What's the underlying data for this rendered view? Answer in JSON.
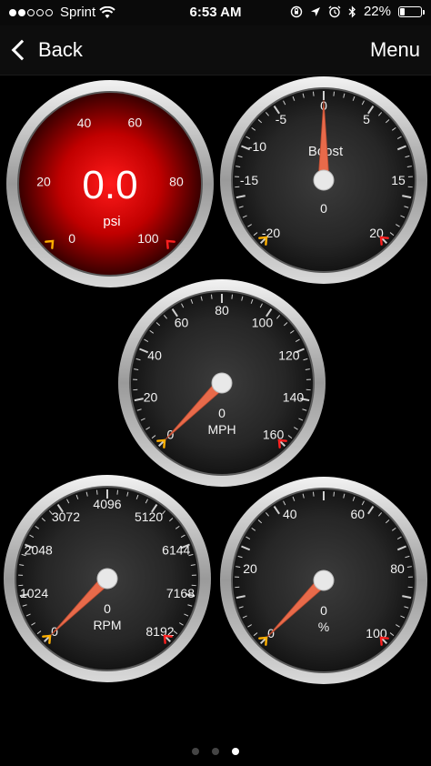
{
  "status": {
    "carrier": "Sprint",
    "time": "6:53 AM",
    "battery": "22%",
    "battery_fraction": 0.22,
    "icons": [
      "wifi-icon",
      "orientation-lock-icon",
      "location-icon",
      "alarm-icon",
      "bluetooth-icon",
      "battery-icon"
    ]
  },
  "nav": {
    "back_label": "Back",
    "menu_label": "Menu"
  },
  "gauges": [
    {
      "id": "pressure",
      "style": "red",
      "min": 0,
      "max": 100,
      "ticks": [
        "0",
        "20",
        "40",
        "60",
        "80",
        "100"
      ],
      "value_text": "0.0",
      "unit": "psi",
      "value": 0,
      "min_marker_color": "#ffb000",
      "max_marker_color": "#ff2020"
    },
    {
      "id": "boost",
      "style": "dark",
      "min": -20,
      "max": 20,
      "ticks": [
        "-20",
        "-15",
        "-10",
        "-5",
        "0",
        "5",
        "15",
        "20"
      ],
      "title": "Boost",
      "value_text": "0",
      "value": 0,
      "needle_color": "#e86a4a",
      "min_marker_color": "#ffb000",
      "max_marker_color": "#ff2020"
    },
    {
      "id": "speed",
      "style": "dark",
      "min": 0,
      "max": 160,
      "ticks": [
        "0",
        "20",
        "40",
        "60",
        "80",
        "100",
        "120",
        "140",
        "160"
      ],
      "value_text": "0",
      "unit": "MPH",
      "value": 0,
      "needle_color": "#e86a4a",
      "min_marker_color": "#ffb000",
      "max_marker_color": "#ff2020"
    },
    {
      "id": "rpm",
      "style": "dark",
      "min": 0,
      "max": 8192,
      "ticks": [
        "0",
        "1024",
        "2048",
        "3072",
        "4096",
        "5120",
        "6144",
        "7168",
        "8192"
      ],
      "value_text": "0",
      "unit": "RPM",
      "value": 0,
      "needle_color": "#e86a4a",
      "min_marker_color": "#ffb000",
      "max_marker_color": "#ff2020"
    },
    {
      "id": "percent",
      "style": "dark",
      "min": 0,
      "max": 100,
      "ticks": [
        "0",
        "20",
        "40",
        "60",
        "80",
        "100"
      ],
      "value_text": "0",
      "unit": "%",
      "value": 0,
      "needle_color": "#e86a4a",
      "min_marker_color": "#ffb000",
      "max_marker_color": "#ff2020"
    }
  ],
  "pager": {
    "count": 3,
    "active": 2
  }
}
